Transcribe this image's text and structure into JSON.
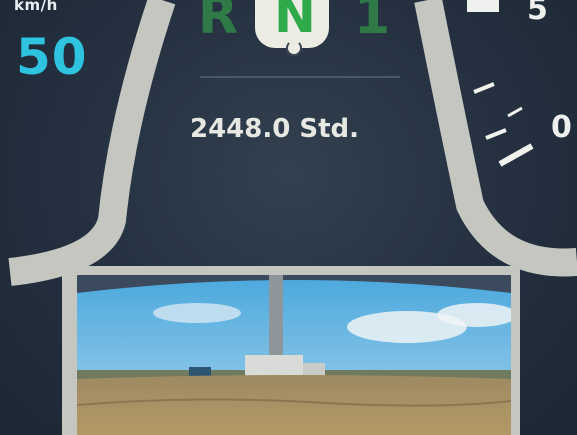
{
  "speed": {
    "unit": "km/h",
    "value": "50"
  },
  "gear": {
    "left": "R",
    "active": "N",
    "right": "1"
  },
  "hours": {
    "text": "2448.0 Std."
  },
  "gauge": {
    "label_5": "5",
    "label_0": "0"
  },
  "colors": {
    "background": "#243040",
    "speed_value": "#2ec4e0",
    "gear_active": "#2faa4a",
    "gear_inactive": "#2f7a47",
    "dial_ring": "#c4c6bf",
    "text": "#e8e8e2"
  },
  "icons": {
    "gear_hook": "hook-icon"
  },
  "camera": {
    "scene": "rear-camera-view"
  }
}
